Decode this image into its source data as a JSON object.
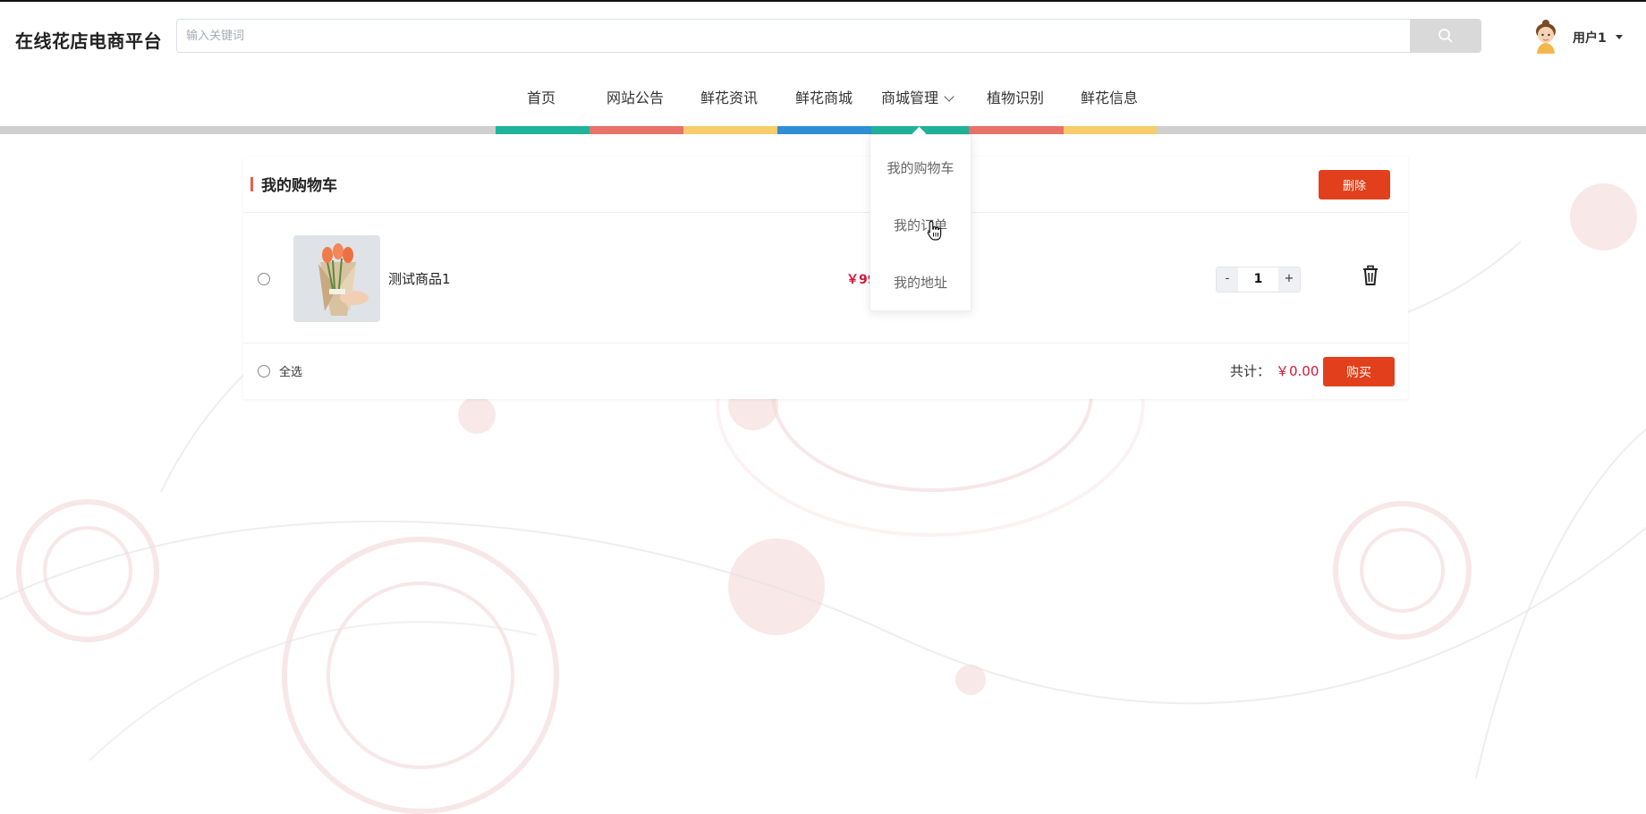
{
  "site_title": "在线花店电商平台",
  "search": {
    "placeholder": "输入关键词",
    "button_icon": "search-icon"
  },
  "user": {
    "name": "用户1",
    "avatar_icon": "cartoon-avatar-icon"
  },
  "nav": {
    "items": [
      "首页",
      "网站公告",
      "鲜花资讯",
      "鲜花商城",
      "商城管理",
      "植物识别",
      "鲜花信息"
    ],
    "stripe_colors": [
      "#1fb39a",
      "#e8726a",
      "#f6cd6a",
      "#2e8fd6",
      "#1fb39a",
      "#e8726a",
      "#f6cd6a"
    ],
    "bar_color": "#cfcfcf"
  },
  "dropdown": {
    "items": [
      "我的购物车",
      "我的订单",
      "我的地址"
    ]
  },
  "cart": {
    "title": "我的购物车",
    "delete_label": "删除",
    "items": [
      {
        "name": "测试商品1",
        "price": "￥99",
        "quantity": "1",
        "selected": false
      }
    ],
    "qty_minus": "-",
    "qty_plus": "+",
    "select_all_label": "全选",
    "total_label": "共计：",
    "total_value": "￥0.00",
    "buy_label": "购买"
  },
  "colors": {
    "accent": "#e2401c",
    "price": "#d6173b"
  }
}
